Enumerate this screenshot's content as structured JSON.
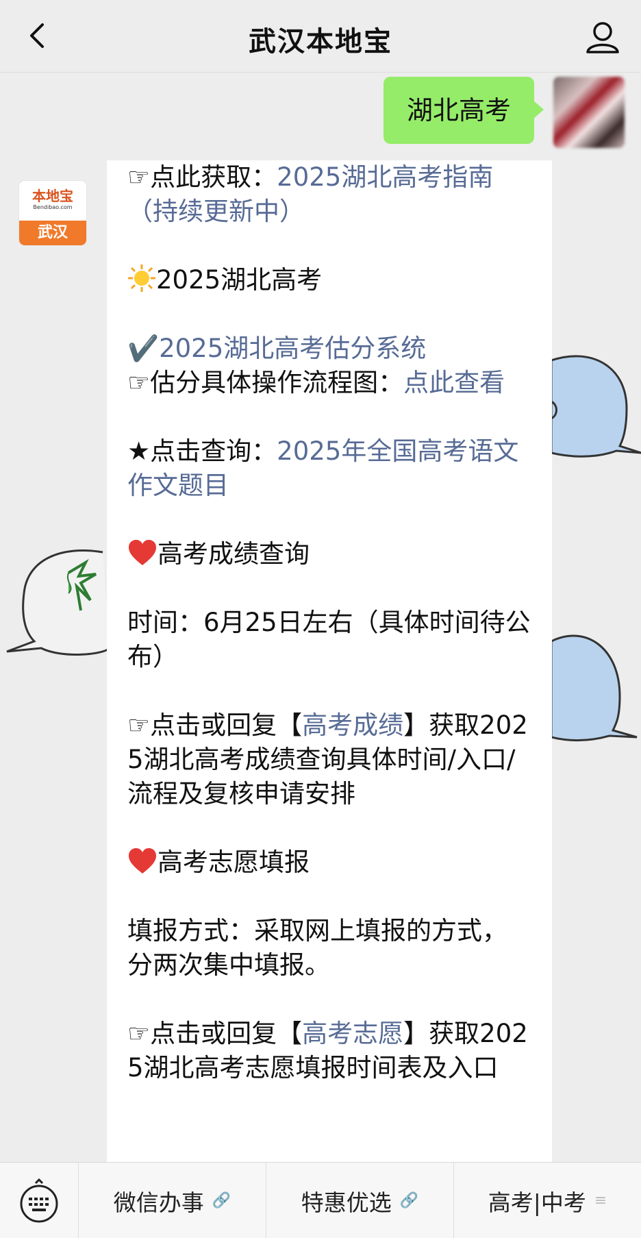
{
  "header": {
    "title": "武汉本地宝"
  },
  "outgoing_message": {
    "text": "湖北高考"
  },
  "account_logo": {
    "top_text": "本地宝",
    "mid_text": "Bendibao.com",
    "bottom_text": "武汉"
  },
  "article": {
    "p1_prefix": "☞点此获取：",
    "p1_link": "2025湖北高考指南（持续更新中）",
    "p2_text": "2025湖北高考",
    "p3_check": "✔️",
    "p3_link": "2025湖北高考估分系统",
    "p3_line2_prefix": "☞估分具体操作流程图：",
    "p3_line2_link": "点此查看",
    "p4_prefix": "★点击查询：",
    "p4_link": "2025年全国高考语文作文题目",
    "p5_text": "高考成绩查询",
    "p6_text": "时间：6月25日左右（具体时间待公布）",
    "p7_prefix": "☞点击或回复【",
    "p7_link": "高考成绩",
    "p7_suffix": "】获取2025湖北高考成绩查询具体时间/入口/流程及复核申请安排",
    "p8_text": "高考志愿填报",
    "p9_text": "填报方式：采取网上填报的方式，分两次集中填报。",
    "p10_prefix": "☞点击或回复【",
    "p10_link": "高考志愿",
    "p10_suffix": "】获取2025湖北高考志愿填报时间表及入口"
  },
  "bottom_menu": {
    "items": [
      {
        "label": "微信办事",
        "icon": "link-icon"
      },
      {
        "label": "特惠优选",
        "icon": "link-icon"
      },
      {
        "label": "高考|中考",
        "icon": "menu-lines-icon"
      }
    ]
  },
  "colors": {
    "link": "#576b95",
    "bubble_green": "#95ec69",
    "logo_orange": "#f07a2a"
  }
}
